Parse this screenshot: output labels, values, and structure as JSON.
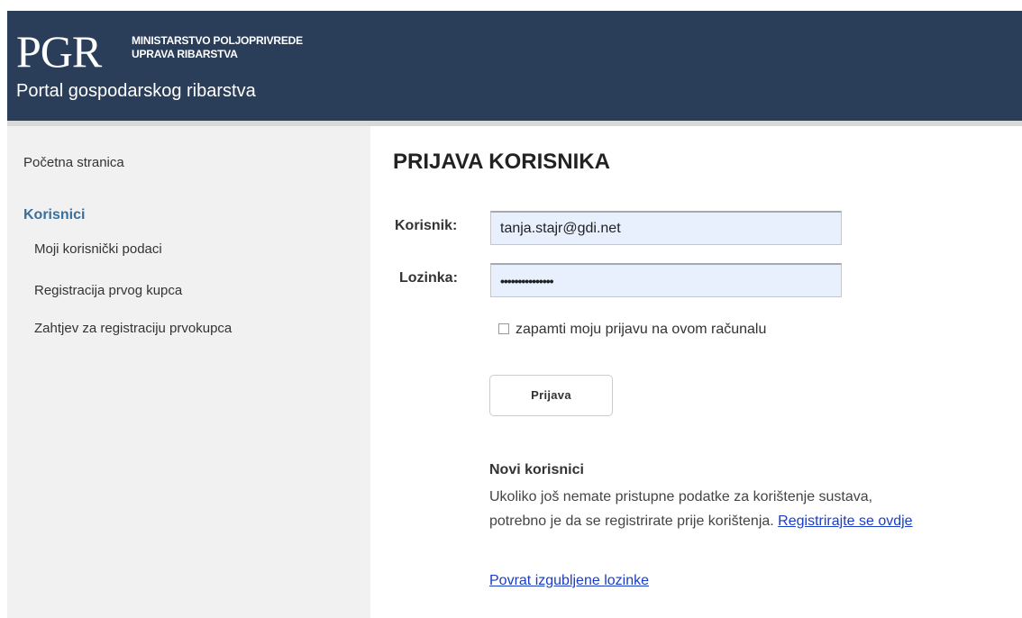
{
  "header": {
    "logo_mark": "PGR",
    "logo_line1": "MINISTARSTVO POLJOPRIVREDE",
    "logo_line2": "UPRAVA RIBARSTVA",
    "portal_title": "Portal gospodarskog ribarstva"
  },
  "sidebar": {
    "home": "Početna stranica",
    "section_title": "Korisnici",
    "items": [
      {
        "label": "Moji korisnički podaci"
      },
      {
        "label": "Registracija prvog kupca"
      },
      {
        "label": "Zahtjev za registraciju prvokupca"
      }
    ]
  },
  "login": {
    "title": "PRIJAVA KORISNIKA",
    "user_label": "Korisnik:",
    "user_value": "tanja.stajr@gdi.net",
    "pass_label": "Lozinka:",
    "pass_value": "•••••••••••••••",
    "remember_label": "zapamti moju prijavu na ovom računalu",
    "remember_checked": false,
    "submit_label": "Prijava"
  },
  "new_users": {
    "title": "Novi korisnici",
    "line1": "Ukoliko još nemate pristupne podatke za korištenje sustava,",
    "line2_text": "potrebno je da se registrirate prije korištenja.",
    "register_link": "Registrirajte se ovdje",
    "lost_password_link": "Povrat izgubljene lozinke"
  },
  "colors": {
    "header_bg": "#2b3e59",
    "sidebar_bg": "#f1f1f1",
    "section_accent": "#3c6e9a",
    "link": "#1a3dc7",
    "input_bg": "#e8f0fe"
  }
}
